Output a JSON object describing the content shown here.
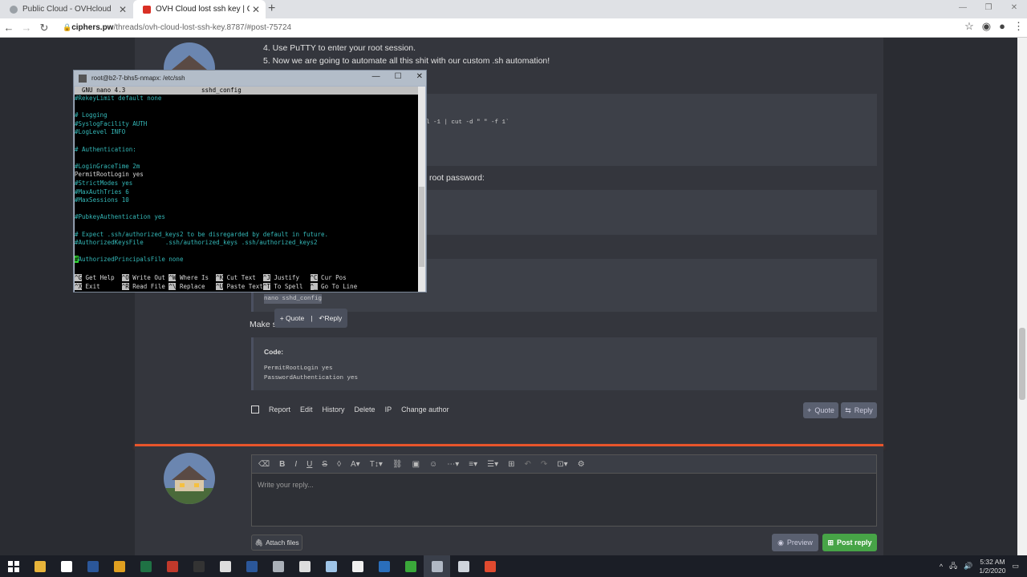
{
  "browser": {
    "tabs": [
      {
        "title": "Public Cloud - OVHcloud",
        "close": "✕",
        "favicon_color": "#9aa0a6"
      },
      {
        "title": "OVH Cloud lost ssh key | Ciphers...",
        "close": "✕",
        "favicon_color": "#d93025"
      }
    ],
    "new_tab": "+",
    "url_domain": "ciphers.pw",
    "url_path": "/threads/ovh-cloud-lost-ssh-key.8787/#post-75724"
  },
  "post": {
    "steps": [
      "4. Use PuTTY to enter your root session.",
      "5. Now we are going to automate all this shit with our custom .sh automation!"
    ],
    "code1_fragment": "l -1 | cut -d \" \" -f 1`",
    "root_password_fragment": "root password:",
    "code3_text": "nano sshd_config",
    "make_fragment": "Make s",
    "code4": {
      "label": "Code:",
      "lines": [
        "PermitRootLogin yes",
        "PasswordAuthentication yes"
      ]
    },
    "actions": [
      "Report",
      "Edit",
      "History",
      "Delete",
      "IP",
      "Change author"
    ],
    "quote_button": "Quote",
    "reply_button": "Reply"
  },
  "tooltip": {
    "quote": "+ Quote",
    "sep": "|",
    "reply": "Reply"
  },
  "reply_editor": {
    "placeholder": "Write your reply...",
    "attach": "Attach files",
    "preview": "Preview",
    "post_reply": "Post reply"
  },
  "putty": {
    "title": "root@b2-7-bhs5-nmapx: /etc/ssh",
    "header": "  GNU nano 4.3                     sshd_config",
    "lines": [
      {
        "t": "#RekeyLimit default none",
        "c": "cm"
      },
      {
        "t": "",
        "c": "wh"
      },
      {
        "t": "# Logging",
        "c": "cm"
      },
      {
        "t": "#SyslogFacility AUTH",
        "c": "cm"
      },
      {
        "t": "#LogLevel INFO",
        "c": "cm"
      },
      {
        "t": "",
        "c": "wh"
      },
      {
        "t": "# Authentication:",
        "c": "cm"
      },
      {
        "t": "",
        "c": "wh"
      },
      {
        "t": "#LoginGraceTime 2m",
        "c": "cm"
      },
      {
        "t": "PermitRootLogin yes",
        "c": "wh"
      },
      {
        "t": "#StrictModes yes",
        "c": "cm"
      },
      {
        "t": "#MaxAuthTries 6",
        "c": "cm"
      },
      {
        "t": "#MaxSessions 10",
        "c": "cm"
      },
      {
        "t": "",
        "c": "wh"
      },
      {
        "t": "#PubkeyAuthentication yes",
        "c": "cm"
      },
      {
        "t": "",
        "c": "wh"
      },
      {
        "t": "# Expect .ssh/authorized_keys2 to be disregarded by default in future.",
        "c": "cm"
      },
      {
        "t": "#AuthorizedKeysFile      .ssh/authorized_keys .ssh/authorized_keys2",
        "c": "cm"
      },
      {
        "t": "",
        "c": "wh"
      }
    ],
    "cursor_line": "AuthorizedPrincipalsFile none",
    "shortcuts_row1": [
      {
        "k": "^G",
        "l": " Get Help  "
      },
      {
        "k": "^O",
        "l": " Write Out "
      },
      {
        "k": "^W",
        "l": " Where Is  "
      },
      {
        "k": "^K",
        "l": " Cut Text  "
      },
      {
        "k": "^J",
        "l": " Justify   "
      },
      {
        "k": "^C",
        "l": " Cur Pos"
      }
    ],
    "shortcuts_row2": [
      {
        "k": "^X",
        "l": " Exit      "
      },
      {
        "k": "^R",
        "l": " Read File "
      },
      {
        "k": "^\\",
        "l": " Replace   "
      },
      {
        "k": "^U",
        "l": " Paste Text"
      },
      {
        "k": "^T",
        "l": " To Spell  "
      },
      {
        "k": "^_",
        "l": " Go To Line"
      }
    ]
  },
  "taskbar": {
    "time": "5:32 AM",
    "date": "1/2/2020",
    "apps": [
      {
        "name": "file-explorer-icon",
        "color": "#e8b43a"
      },
      {
        "name": "mail-icon",
        "color": "#ffffff"
      },
      {
        "name": "word-app-icon",
        "color": "#2b579a"
      },
      {
        "name": "chrome-icon",
        "color": "#e0a020"
      },
      {
        "name": "excel-icon",
        "color": "#1f7244"
      },
      {
        "name": "red-app-icon",
        "color": "#c0392b"
      },
      {
        "name": "terminal-icon",
        "color": "#333333"
      },
      {
        "name": "red-circle-icon",
        "color": "#dddddd"
      },
      {
        "name": "word-icon",
        "color": "#2b579a"
      },
      {
        "name": "network-icon",
        "color": "#aab0b8"
      },
      {
        "name": "calculator-icon",
        "color": "#dddddd"
      },
      {
        "name": "notepad-icon",
        "color": "#9fc5e8"
      },
      {
        "name": "store-icon",
        "color": "#f0f0f0"
      },
      {
        "name": "powershell-icon",
        "color": "#2a6ebb"
      },
      {
        "name": "camtasia-icon",
        "color": "#3aa83a"
      },
      {
        "name": "putty-icon",
        "color": "#b0b8c4"
      },
      {
        "name": "ssh-client-icon",
        "color": "#cfd5dc"
      },
      {
        "name": "red-c-icon",
        "color": "#e04a2f"
      }
    ]
  }
}
